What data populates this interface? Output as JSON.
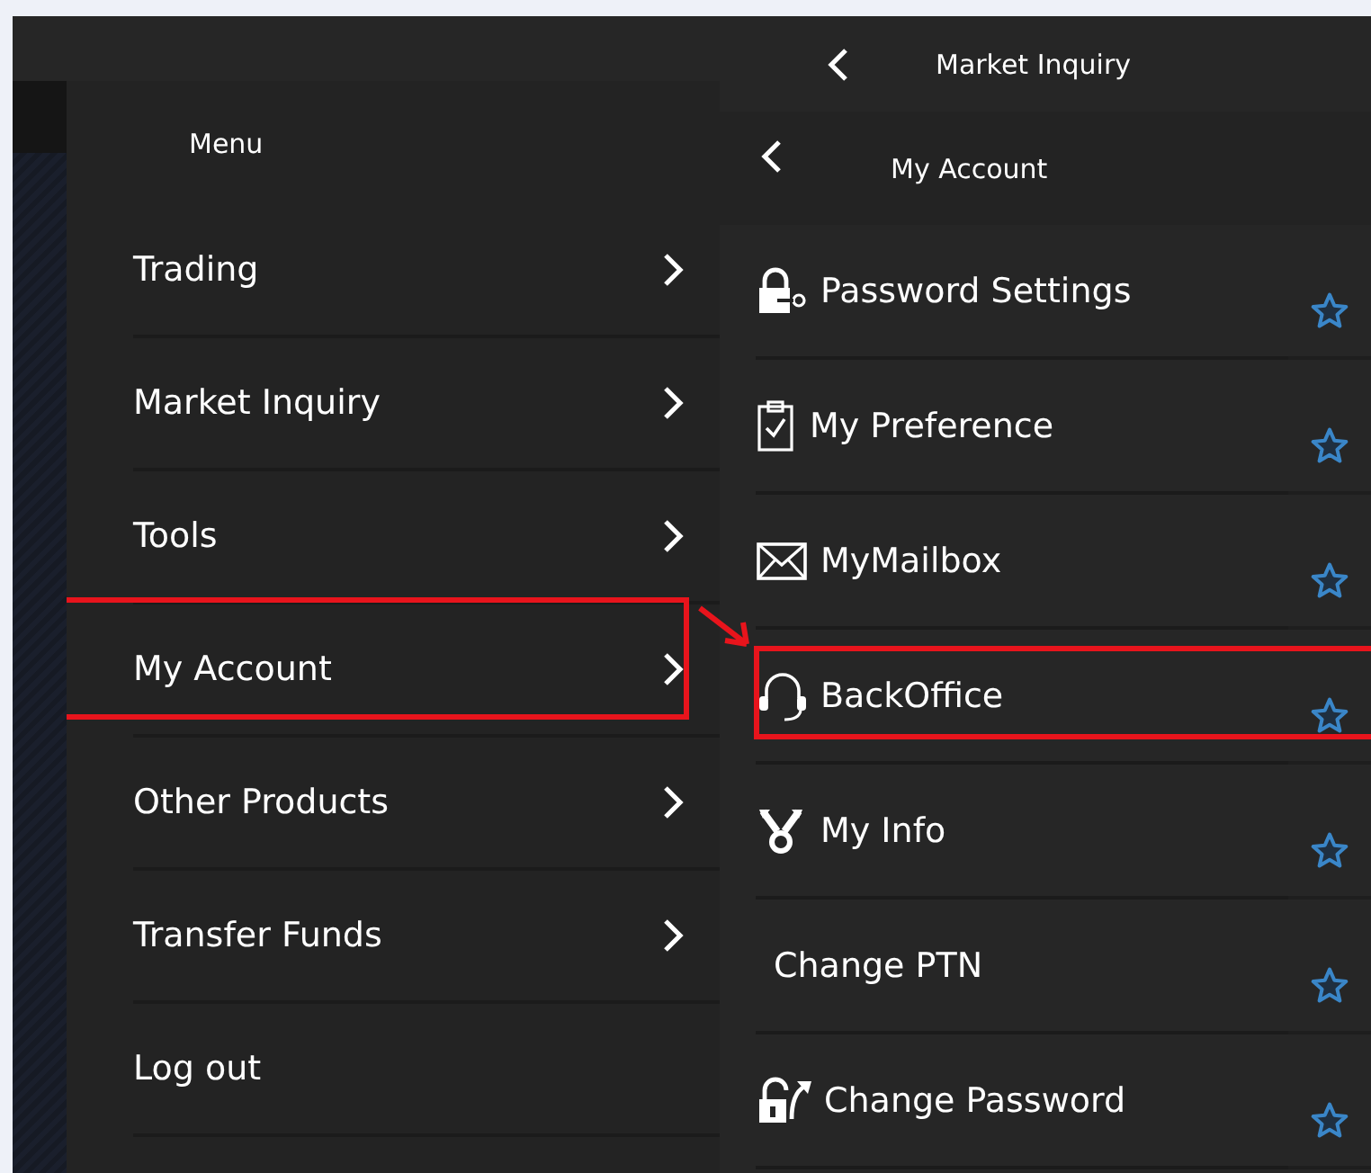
{
  "menu": {
    "title": "Menu",
    "items": [
      {
        "label": "Trading",
        "submenu": true,
        "highlighted": false
      },
      {
        "label": "Market Inquiry",
        "submenu": true,
        "highlighted": false
      },
      {
        "label": "Tools",
        "submenu": true,
        "highlighted": false
      },
      {
        "label": "My Account",
        "submenu": true,
        "highlighted": true
      },
      {
        "label": "Other Products",
        "submenu": true,
        "highlighted": false
      },
      {
        "label": "Transfer Funds",
        "submenu": true,
        "highlighted": false
      },
      {
        "label": "Log out",
        "submenu": false,
        "highlighted": false
      }
    ]
  },
  "breadcrumbs": [
    {
      "label": "Market Inquiry"
    },
    {
      "label": "My Account"
    }
  ],
  "submenu": {
    "items": [
      {
        "kind": "lock-key",
        "label": "Password Settings",
        "favorite": false,
        "highlighted": false
      },
      {
        "kind": "clipboard",
        "label": "My Preference",
        "favorite": false,
        "highlighted": false
      },
      {
        "kind": "mail",
        "label": "MyMailbox",
        "favorite": false,
        "highlighted": false
      },
      {
        "kind": "headset",
        "label": "BackOffice",
        "favorite": false,
        "highlighted": true
      },
      {
        "kind": "network",
        "label": "My Info",
        "favorite": false,
        "highlighted": false
      },
      {
        "kind": "none",
        "label": "Change PTN",
        "favorite": false,
        "highlighted": false
      },
      {
        "kind": "lock-open",
        "label": "Change Password",
        "favorite": false,
        "highlighted": false
      }
    ]
  }
}
